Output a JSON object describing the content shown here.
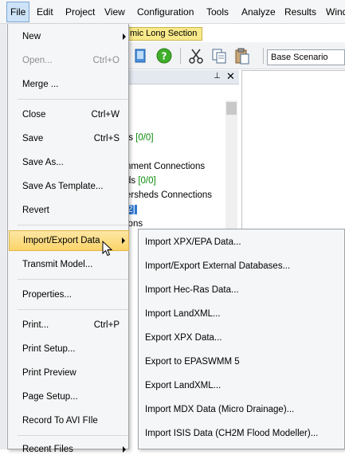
{
  "menubar": {
    "items": [
      {
        "label": "File"
      },
      {
        "label": "Edit"
      },
      {
        "label": "Project"
      },
      {
        "label": "View"
      },
      {
        "label": "Configuration"
      },
      {
        "label": "Tools"
      },
      {
        "label": "Analyze"
      },
      {
        "label": "Results"
      },
      {
        "label": "Wind"
      }
    ]
  },
  "document_tab": {
    "label": "mic Long Section"
  },
  "toolbar": {
    "scenario_value": "Base Scenario",
    "icons": [
      "page-icon",
      "help-icon",
      "cut-icon",
      "copy-icon",
      "paste-icon"
    ]
  },
  "tree": {
    "lines": [
      {
        "text": "]"
      },
      {
        "text": "ts ",
        "count": "[0/0]"
      },
      {
        "text": "nment Connections"
      },
      {
        "text": "ds ",
        "count": "[0/0]"
      },
      {
        "text": "ersheds Connections"
      },
      {
        "text": "2]"
      },
      {
        "text": "ions"
      }
    ]
  },
  "file_menu": {
    "items": [
      {
        "label": "New",
        "shortcut": "",
        "submenu": true
      },
      {
        "label": "Open...",
        "shortcut": "Ctrl+O"
      },
      {
        "label": "Merge ...",
        "shortcut": ""
      },
      {
        "label": "Close",
        "shortcut": "Ctrl+W"
      },
      {
        "label": "Save",
        "shortcut": "Ctrl+S"
      },
      {
        "label": "Save As...",
        "shortcut": ""
      },
      {
        "label": "Save As Template...",
        "shortcut": ""
      },
      {
        "label": "Revert",
        "shortcut": ""
      },
      {
        "label": "Import/Export Data",
        "shortcut": "",
        "submenu": true
      },
      {
        "label": "Transmit Model...",
        "shortcut": ""
      },
      {
        "label": "Properties...",
        "shortcut": ""
      },
      {
        "label": "Print...",
        "shortcut": "Ctrl+P"
      },
      {
        "label": "Print Setup...",
        "shortcut": ""
      },
      {
        "label": "Print Preview",
        "shortcut": ""
      },
      {
        "label": "Page Setup...",
        "shortcut": ""
      },
      {
        "label": "Record To AVI FIle",
        "shortcut": ""
      },
      {
        "label": "Recent Files",
        "shortcut": "",
        "submenu": true
      }
    ]
  },
  "import_export_submenu": {
    "items": [
      {
        "label": "Import XPX/EPA Data..."
      },
      {
        "label": "Import/Export External Databases..."
      },
      {
        "label": "Import Hec-Ras Data..."
      },
      {
        "label": "Import LandXML..."
      },
      {
        "label": "Export XPX Data..."
      },
      {
        "label": "Export to EPASWMM 5"
      },
      {
        "label": "Export LandXML..."
      },
      {
        "label": "Import MDX Data (Micro Drainage)..."
      },
      {
        "label": "Import ISIS Data (CH2M Flood Modeller)..."
      }
    ]
  },
  "colors": {
    "highlight": "#fbd46a",
    "tree_count": "#0a8a0a",
    "tree_selection": "#2f78d1"
  }
}
